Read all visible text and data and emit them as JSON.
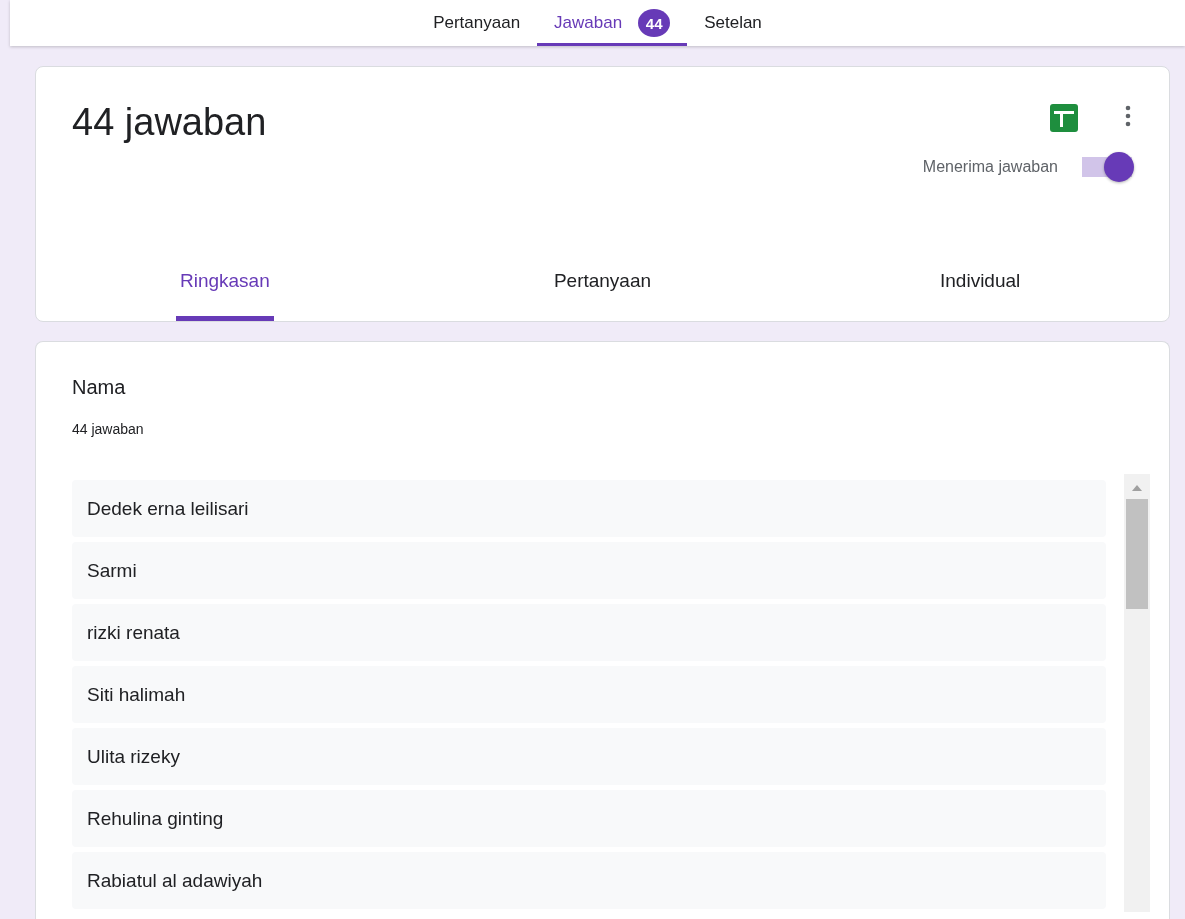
{
  "top_tabs": [
    {
      "label": "Pertanyaan",
      "selected": false
    },
    {
      "label": "Jawaban",
      "selected": true,
      "badge": "44"
    },
    {
      "label": "Setelan",
      "selected": false
    }
  ],
  "summary_card": {
    "title": "44 jawaban",
    "accepting_label": "Menerima jawaban",
    "accepting": true,
    "tabs": [
      {
        "label": "Ringkasan",
        "selected": true
      },
      {
        "label": "Pertanyaan",
        "selected": false
      },
      {
        "label": "Individual",
        "selected": false
      }
    ]
  },
  "question_card": {
    "title": "Nama",
    "count": "44 jawaban",
    "answers": [
      "Dedek erna leilisari",
      "Sarmi",
      "rizki renata",
      "Siti halimah",
      "Ulita rizeky",
      "Rehulina ginting",
      "Rabiatul al adawiyah"
    ]
  }
}
